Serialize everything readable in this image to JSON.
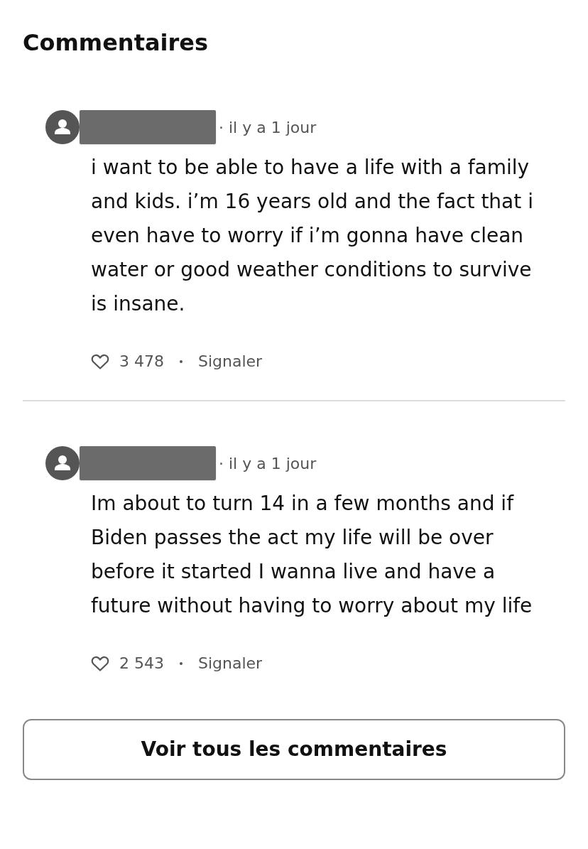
{
  "title": "Commentaires",
  "comments": [
    {
      "time": "· il y a 1 jour",
      "text": "i want to be able to have a life with a family and kids. i’m 16 years old and the fact that i even have to worry if i’m gonna have clean water or good weather conditions to survive is insane.",
      "likes": "3 478",
      "report": "Signaler"
    },
    {
      "time": "· il y a 1 jour",
      "text": "Im about to turn 14 in a few months and if Biden passes the act my life will be over before it started I wanna live and have a future without having to worry about my life",
      "likes": "2 543",
      "report": "Signaler"
    }
  ],
  "button": "Voir tous les commentaires"
}
